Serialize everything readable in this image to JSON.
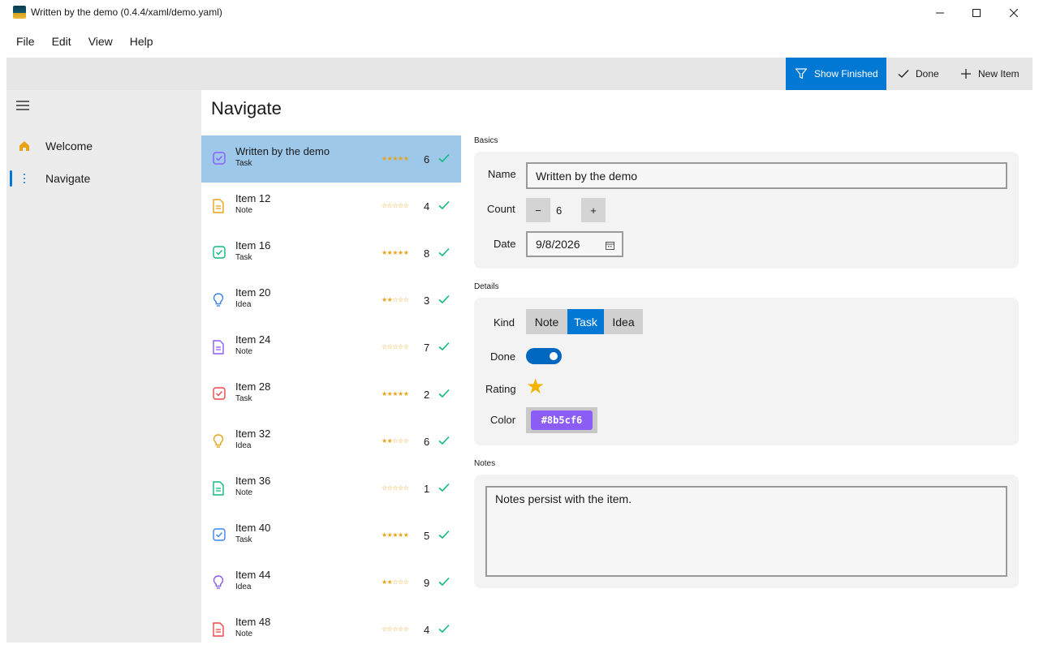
{
  "window": {
    "title": "Written by the demo (0.4.4/xaml/demo.yaml)",
    "icon": "app-icon"
  },
  "menu": [
    {
      "label": "File"
    },
    {
      "label": "Edit"
    },
    {
      "label": "View"
    },
    {
      "label": "Help"
    }
  ],
  "commandbar": {
    "show_finished": {
      "label": "Show Finished",
      "icon": "filter-icon",
      "active": true
    },
    "done": {
      "label": "Done",
      "icon": "check-icon"
    },
    "new_item": {
      "label": "New Item",
      "icon": "plus-icon"
    }
  },
  "nav": {
    "items": [
      {
        "label": "Welcome",
        "icon": "home-icon"
      },
      {
        "label": "Navigate",
        "icon": "dots-icon",
        "selected": true
      }
    ]
  },
  "page": {
    "title": "Navigate"
  },
  "list": [
    {
      "name": "Written by the demo",
      "kind": "Task",
      "stars": "★★★★★",
      "count": "6",
      "icon": "checkbox-icon",
      "color": "#8b5cf6",
      "selected": true
    },
    {
      "name": "Item 12",
      "kind": "Note",
      "stars": "☆☆☆☆☆",
      "count": "4",
      "icon": "document-icon",
      "color": "#e8a317"
    },
    {
      "name": "Item 16",
      "kind": "Task",
      "stars": "★★★★★",
      "count": "8",
      "icon": "checkbox-icon",
      "color": "#10b981"
    },
    {
      "name": "Item 20",
      "kind": "Idea",
      "stars": "★★☆☆☆",
      "count": "3",
      "icon": "lightbulb-icon",
      "color": "#3b82f6"
    },
    {
      "name": "Item 24",
      "kind": "Note",
      "stars": "☆☆☆☆☆",
      "count": "7",
      "icon": "document-icon",
      "color": "#8b5cf6"
    },
    {
      "name": "Item 28",
      "kind": "Task",
      "stars": "★★★★★",
      "count": "2",
      "icon": "checkbox-icon",
      "color": "#ef4444"
    },
    {
      "name": "Item 32",
      "kind": "Idea",
      "stars": "★★☆☆☆",
      "count": "6",
      "icon": "lightbulb-icon",
      "color": "#e8a317"
    },
    {
      "name": "Item 36",
      "kind": "Note",
      "stars": "☆☆☆☆☆",
      "count": "1",
      "icon": "document-icon",
      "color": "#10b981"
    },
    {
      "name": "Item 40",
      "kind": "Task",
      "stars": "★★★★★",
      "count": "5",
      "icon": "checkbox-icon",
      "color": "#3b82f6"
    },
    {
      "name": "Item 44",
      "kind": "Idea",
      "stars": "★★☆☆☆",
      "count": "9",
      "icon": "lightbulb-icon",
      "color": "#8b5cf6"
    },
    {
      "name": "Item 48",
      "kind": "Note",
      "stars": "☆☆☆☆☆",
      "count": "4",
      "icon": "document-icon",
      "color": "#ef4444"
    }
  ],
  "detail": {
    "basics_label": "Basics",
    "name_label": "Name",
    "name_value": "Written by the demo",
    "count_label": "Count",
    "count_value": "6",
    "decrement": "−",
    "increment": "+",
    "date_label": "Date",
    "date_value": "9/8/2026",
    "details_label": "Details",
    "kind_label": "Kind",
    "kind_options": [
      "Note",
      "Task",
      "Idea"
    ],
    "kind_selected": "Task",
    "done_label": "Done",
    "done_value": true,
    "rating_label": "Rating",
    "rating_star": "★",
    "color_label": "Color",
    "color_value": "#8b5cf6",
    "notes_label": "Notes",
    "notes_value": "Notes persist with the item."
  },
  "colors": {
    "accent": "#0078d4",
    "selection": "#9ec8ea",
    "star": "#e8a317",
    "check": "#10b981"
  }
}
